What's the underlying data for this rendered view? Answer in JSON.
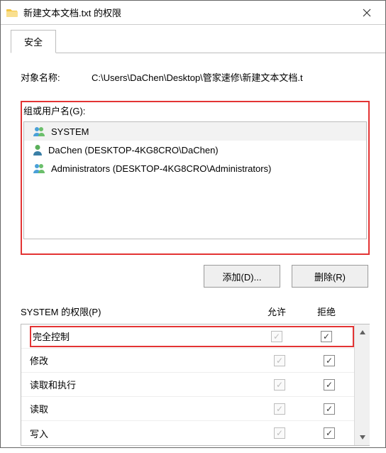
{
  "titlebar": {
    "title": "新建文本文档.txt 的权限"
  },
  "tabs": {
    "security": "安全"
  },
  "object": {
    "label": "对象名称:",
    "path": "C:\\Users\\DaChen\\Desktop\\管家速修\\新建文本文档.t"
  },
  "groups": {
    "label": "组或用户名(G):",
    "items": [
      {
        "name": "SYSTEM",
        "icon": "people",
        "text": "SYSTEM",
        "selected": true
      },
      {
        "name": "DaChen",
        "icon": "person",
        "text": "DaChen (DESKTOP-4KG8CRO\\DaChen)",
        "selected": false
      },
      {
        "name": "Administrators",
        "icon": "people",
        "text": "Administrators (DESKTOP-4KG8CRO\\Administrators)",
        "selected": false
      }
    ]
  },
  "buttons": {
    "add": "添加(D)...",
    "remove": "删除(R)"
  },
  "permissions": {
    "header_label": "SYSTEM 的权限(P)",
    "col_allow": "允许",
    "col_deny": "拒绝",
    "rows": [
      {
        "name": "完全控制",
        "allow_checked": true,
        "allow_enabled": false,
        "deny_checked": true,
        "deny_enabled": true,
        "highlight": true
      },
      {
        "name": "修改",
        "allow_checked": true,
        "allow_enabled": false,
        "deny_checked": true,
        "deny_enabled": true,
        "highlight": false
      },
      {
        "name": "读取和执行",
        "allow_checked": true,
        "allow_enabled": false,
        "deny_checked": true,
        "deny_enabled": true,
        "highlight": false
      },
      {
        "name": "读取",
        "allow_checked": true,
        "allow_enabled": false,
        "deny_checked": true,
        "deny_enabled": true,
        "highlight": false
      },
      {
        "name": "写入",
        "allow_checked": true,
        "allow_enabled": false,
        "deny_checked": true,
        "deny_enabled": true,
        "highlight": false
      }
    ]
  }
}
